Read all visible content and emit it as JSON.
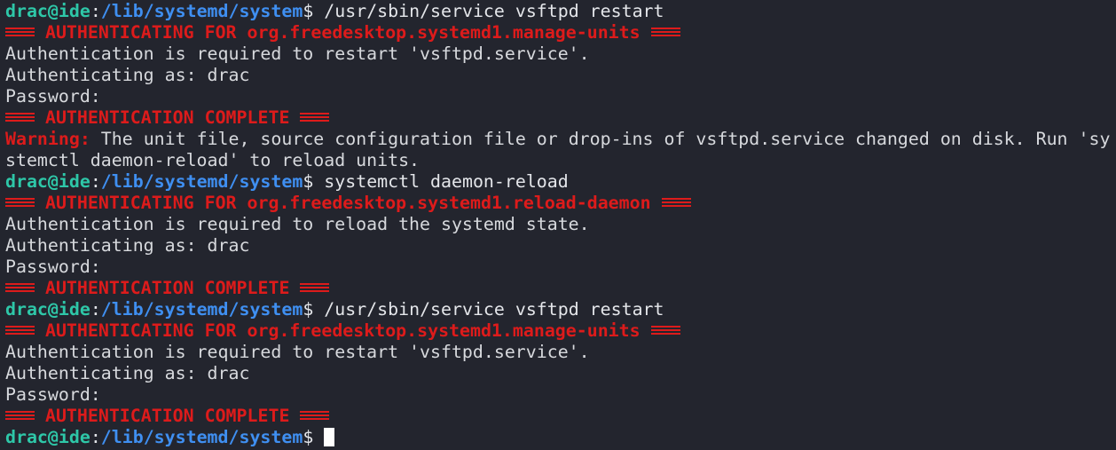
{
  "prompt": {
    "user_host": "drac@ide",
    "colon": ":",
    "path": "/lib/systemd/system",
    "symbol": "$"
  },
  "commands": {
    "c1": " /usr/sbin/service vsftpd restart",
    "c2": " systemctl daemon-reload",
    "c3": " /usr/sbin/service vsftpd restart"
  },
  "auth": {
    "header_manage": "AUTHENTICATING FOR org.freedesktop.systemd1.manage-units",
    "header_reload": "AUTHENTICATING FOR org.freedesktop.systemd1.reload-daemon",
    "complete": "AUTHENTICATION COMPLETE",
    "required_restart": "Authentication is required to restart 'vsftpd.service'.",
    "required_reload": "Authentication is required to reload the systemd state.",
    "as": "Authenticating as: drac",
    "password": "Password:"
  },
  "warning": {
    "label": "Warning:",
    "text1": " The unit file, source configuration file or drop-ins of vsftpd.service changed on disk. Run 'sy",
    "text2": "stemctl daemon-reload' to reload units."
  },
  "colors": {
    "background": "#23252e",
    "user": "#2ec7a8",
    "path": "#3f8ff1",
    "alert": "#dd1b1b",
    "text": "#d7d9dd"
  }
}
